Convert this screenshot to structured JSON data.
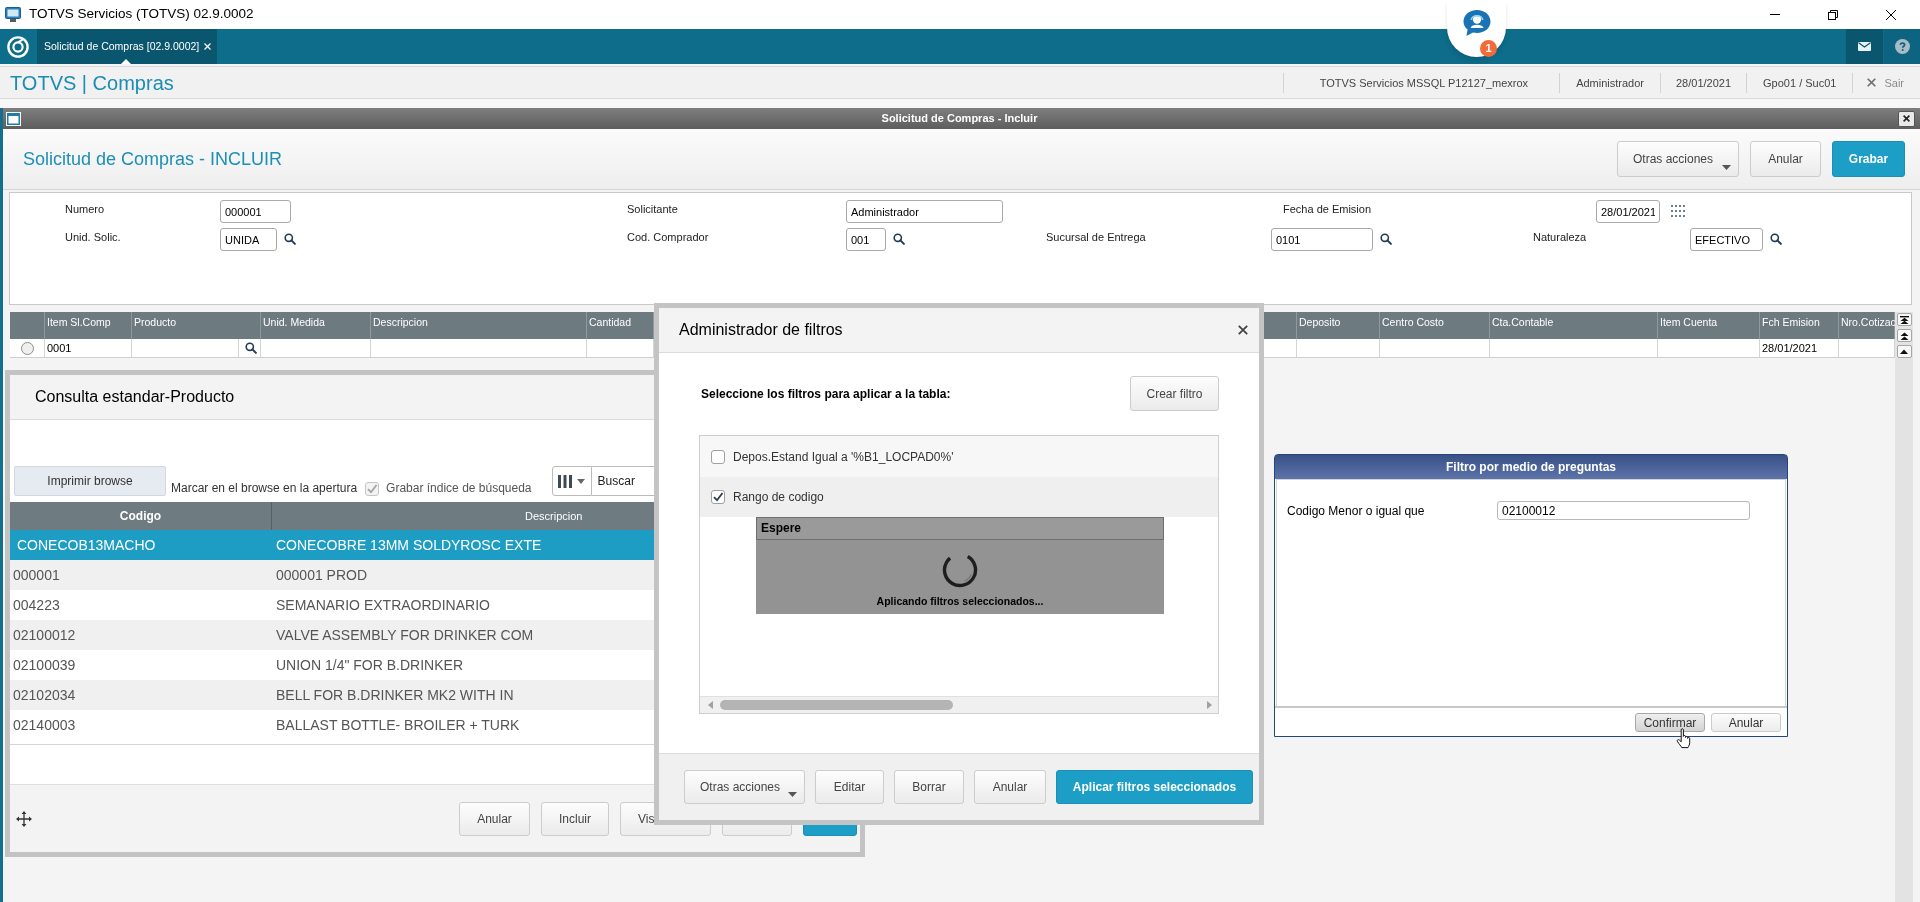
{
  "window": {
    "title": "TOTVS Servicios (TOTVS) 02.9.0002"
  },
  "tab_bar": {
    "tabs": [
      {
        "label": "Solicitud de Compras [02.9.0002]",
        "selected": true
      }
    ],
    "chat_badge": "1"
  },
  "header": {
    "title": "TOTVS | Compras",
    "info": [
      "TOTVS Servicios MSSQL P12127_mexrox",
      "Administrador",
      "28/01/2021",
      "Gpo01 / Suc01"
    ],
    "exit": "Sair"
  },
  "routine_bar": {
    "title": "Solicitud de Compras - Incluir"
  },
  "page_header": {
    "title": "Solicitud de Compras - INCLUIR",
    "buttons": [
      {
        "label": "Otras acciones",
        "kind": "menu"
      },
      {
        "label": "Anular",
        "kind": "default"
      },
      {
        "label": "Grabar",
        "kind": "primary"
      }
    ]
  },
  "form": {
    "rows": [
      [
        {
          "label": "Numero",
          "value": "000001",
          "kind": "text"
        },
        {
          "label": "Solicitante",
          "value": "Administrador",
          "kind": "text"
        },
        {
          "label": "Fecha de Emision",
          "value": "28/01/2021",
          "kind": "date"
        }
      ],
      [
        {
          "label": "Unid. Solic.",
          "value": "UNIDA",
          "kind": "lookup"
        },
        {
          "label": "Cod. Comprador",
          "value": "001",
          "kind": "lookup"
        },
        {
          "label": "Sucursal de Entrega",
          "value": "0101",
          "kind": "lookup"
        },
        {
          "label": "Naturaleza",
          "value": "EFECTIVO",
          "kind": "lookup"
        }
      ]
    ]
  },
  "grid": {
    "columns": [
      {
        "label": "Item Sl.Comp",
        "kind": "text"
      },
      {
        "label": "Producto",
        "kind": "lookup"
      },
      {
        "label": "Unid. Medida",
        "kind": "text"
      },
      {
        "label": "Descripcion",
        "kind": "text"
      },
      {
        "label": "Cantidad",
        "kind": "text"
      },
      {
        "label": "Deposito",
        "kind": "text"
      },
      {
        "label": "Centro Costo",
        "kind": "text"
      },
      {
        "label": "Cta.Contable",
        "kind": "text"
      },
      {
        "label": "Item Cuenta",
        "kind": "text"
      },
      {
        "label": "Fch Emision",
        "kind": "text"
      },
      {
        "label": "Nro.Cotizac",
        "kind": "text"
      }
    ],
    "rows": [
      {
        "selected": false,
        "item_sl_comp": "0001",
        "fch_emision": "28/01/2021"
      }
    ]
  },
  "product_lookup": {
    "title": "Consulta estandar-Producto",
    "print_button": "Imprimir browse",
    "mark_label": "Marcar en el browse en la apertura",
    "save_index": {
      "label": "Grabar índice de búsqueda",
      "checked": true,
      "disabled": true
    },
    "search": {
      "placeholder": "Buscar"
    },
    "columns": [
      {
        "label": "Codigo",
        "sorted": true
      },
      {
        "label": "Descripcion",
        "sorted": false
      }
    ],
    "rows": [
      {
        "codigo": "CONECOB13MACHO",
        "descripcion": "CONECOBRE 13MM SOLDYROSC EXTE",
        "selected": true
      },
      {
        "codigo": "000001",
        "descripcion": "000001 PROD",
        "selected": false
      },
      {
        "codigo": "004223",
        "descripcion": "SEMANARIO EXTRAORDINARIO",
        "selected": false
      },
      {
        "codigo": "02100012",
        "descripcion": "VALVE ASSEMBLY FOR DRINKER COM",
        "selected": false
      },
      {
        "codigo": "02100039",
        "descripcion": "UNION 1/4\" FOR B.DRINKER",
        "selected": false
      },
      {
        "codigo": "02102034",
        "descripcion": "BELL FOR B.DRINKER MK2 WITH IN",
        "selected": false
      },
      {
        "codigo": "02140003",
        "descripcion": "BALLAST BOTTLE- BROILER + TURK",
        "selected": false
      }
    ],
    "buttons": [
      {
        "label": "Anular",
        "kind": "default"
      },
      {
        "label": "Incluir",
        "kind": "default"
      },
      {
        "label": "Vis",
        "kind": "default"
      },
      {
        "kind": "default"
      },
      {
        "kind": "primary"
      }
    ]
  },
  "filter_manager": {
    "title": "Administrador de filtros",
    "prompt": "Seleccione los filtros para aplicar a la tabla:",
    "create_button": "Crear filtro",
    "filters": [
      {
        "label": "Depos.Estand Igual a '%B1_LOCPAD0%'",
        "checked": false
      },
      {
        "label": "Rango de codigo",
        "checked": true
      }
    ],
    "wait_box": {
      "title": "Espere",
      "message": "Aplicando filtros seleccionados..."
    },
    "buttons": [
      {
        "label": "Otras acciones",
        "kind": "menu"
      },
      {
        "label": "Editar",
        "kind": "default"
      },
      {
        "label": "Borrar",
        "kind": "default"
      },
      {
        "label": "Anular",
        "kind": "default"
      },
      {
        "label": "Aplicar filtros seleccionados",
        "kind": "primary"
      }
    ]
  },
  "question_dialog": {
    "title": "Filtro por medio de preguntas",
    "fields": [
      {
        "label": "Codigo Menor o igual que",
        "value": "02100012"
      }
    ],
    "buttons": [
      {
        "label": "Confirmar",
        "hovered": true
      },
      {
        "label": "Anular",
        "hovered": false
      }
    ]
  }
}
